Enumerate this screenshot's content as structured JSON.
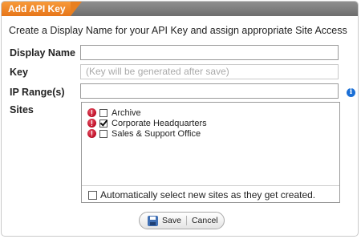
{
  "dialog": {
    "title": "Add API Key"
  },
  "intro_text": "Create a Display Name for your API Key and assign appropriate Site Access",
  "fields": {
    "display_name": {
      "label": "Display Name",
      "value": ""
    },
    "key": {
      "label": "Key",
      "value": "(Key will be generated after save)"
    },
    "ip_ranges": {
      "label": "IP Range(s)",
      "value": ""
    }
  },
  "sites": {
    "label": "Sites",
    "items": [
      {
        "name": "Archive",
        "checked": false
      },
      {
        "name": "Corporate Headquarters",
        "checked": true
      },
      {
        "name": "Sales & Support Office",
        "checked": false
      }
    ],
    "auto_select_label": "Automatically select new sites as they get created.",
    "auto_select_checked": false
  },
  "buttons": {
    "save": "Save",
    "cancel": "Cancel"
  },
  "colors": {
    "title_tab": "#f08a2a",
    "title_strip": "#7d7d7d",
    "info_icon": "#1a6fd6",
    "alert": "#c5132b"
  },
  "icons": {
    "info": "info-icon",
    "site_alert": "alert-icon",
    "save": "floppy-disk-icon"
  }
}
